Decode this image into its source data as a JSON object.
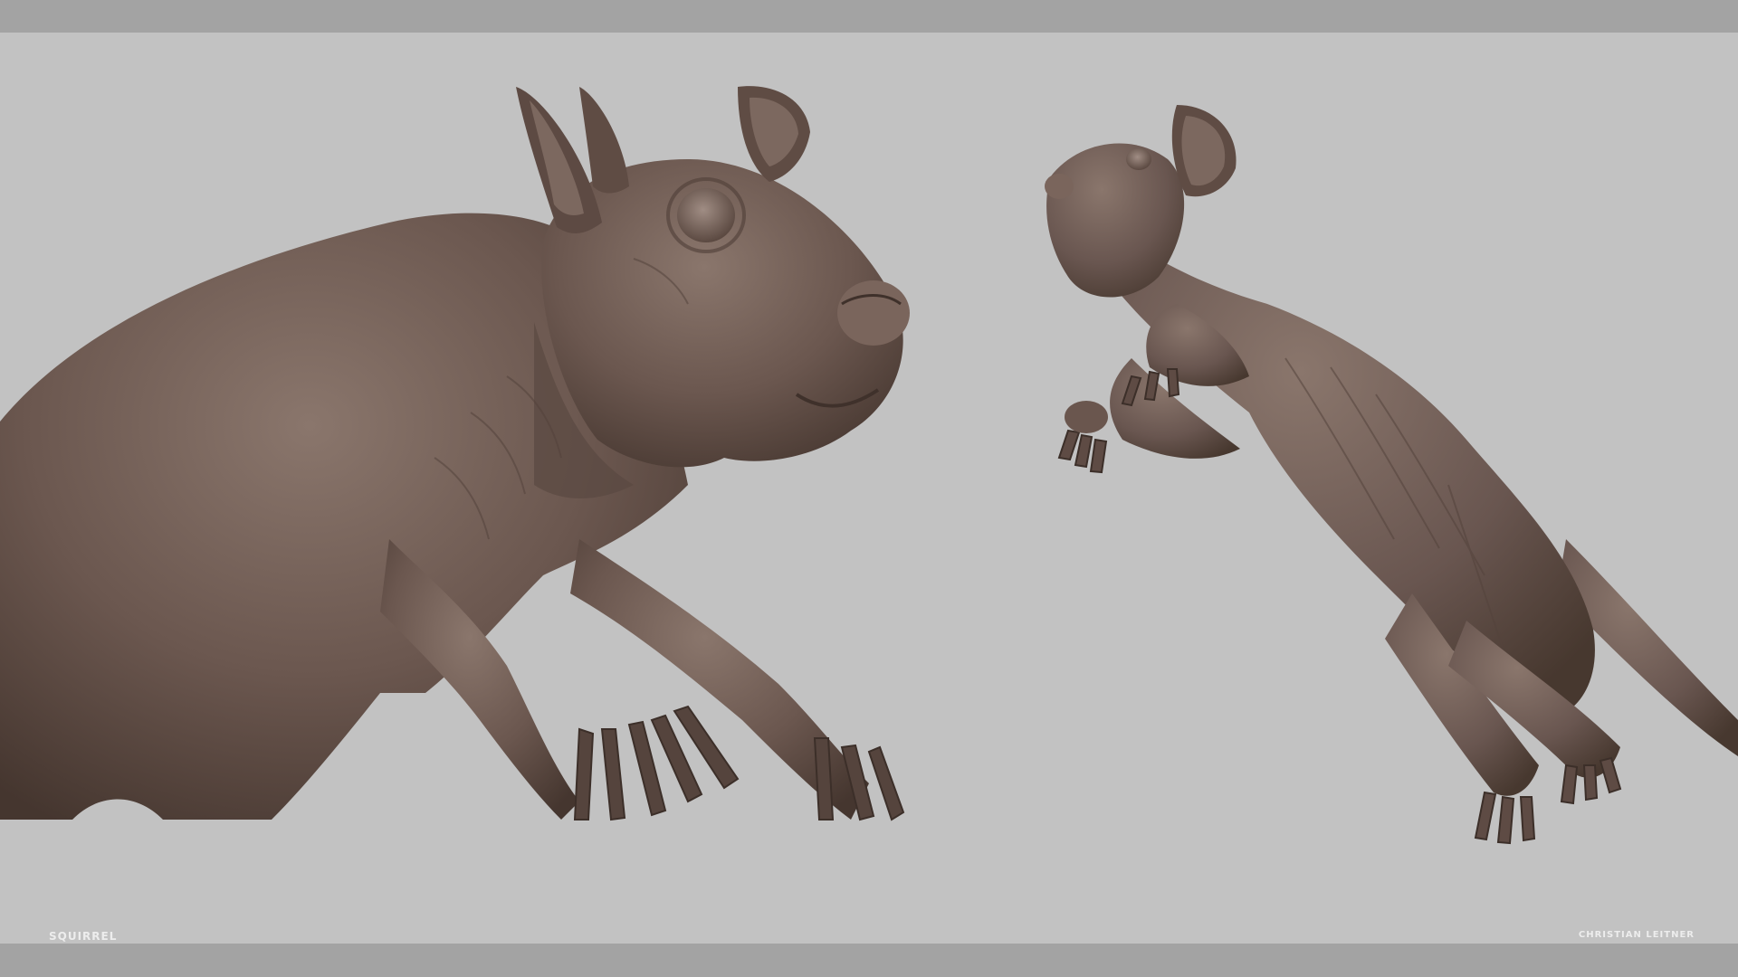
{
  "caption_left": "SQUIRREL",
  "caption_right": "CHRISTIAN LEITNER",
  "colors": {
    "frame": "#a6a6a6",
    "background": "#c2c2c2",
    "sculpt": "#6e5a52",
    "sculpt_dark": "#4a3b35",
    "sculpt_light": "#8f7a70",
    "caption": "#ededed"
  }
}
